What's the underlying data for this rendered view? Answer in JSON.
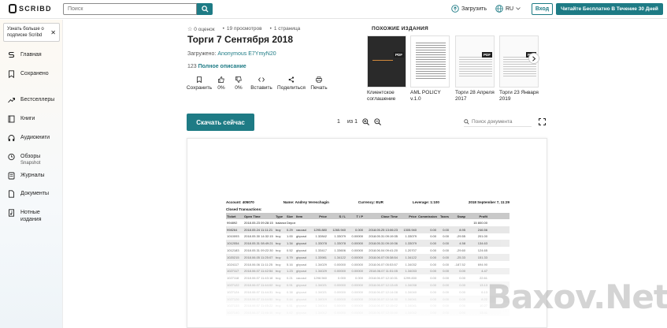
{
  "header": {
    "logo_text": "SCRIBD",
    "search_placeholder": "Поиск",
    "upload_label": "Загрузить",
    "lang_label": "RU",
    "login_label": "Вход",
    "cta_label": "Читайте Бесплатно В Течение 30 Дней"
  },
  "sidebar": {
    "promo_text": "Узнать больше о подписке Scribd",
    "items": [
      {
        "label": "Главная",
        "icon": "scribd-home-icon"
      },
      {
        "label": "Сохранено",
        "icon": "bookmark-icon"
      },
      {
        "label": "Бестселлеры",
        "icon": "trend-icon"
      },
      {
        "label": "Книги",
        "icon": "book-icon"
      },
      {
        "label": "Аудиокниги",
        "icon": "headphones-icon"
      },
      {
        "label": "Обзоры",
        "sub": "Snapshot",
        "icon": "snapshot-icon"
      },
      {
        "label": "Журналы",
        "icon": "magazine-icon"
      },
      {
        "label": "Документы",
        "icon": "document-icon"
      },
      {
        "label": "Нотные издания",
        "icon": "sheet-music-icon"
      }
    ]
  },
  "doc": {
    "rating": "0 оценок",
    "views": "19 просмотров",
    "pages": "1 страница",
    "title": "Торги 7 Сентября 2018",
    "uploaded_prefix": "Загружено:",
    "author": "Anonymous E7YmyN20",
    "desc_count": "123",
    "desc_link": "Полное описание",
    "actions": [
      {
        "label": "Сохранить",
        "icon": "bookmark-icon"
      },
      {
        "label": "0%",
        "icon": "thumbs-up-icon"
      },
      {
        "label": "0%",
        "icon": "thumbs-down-icon"
      },
      {
        "label": "Вставить",
        "icon": "embed-icon"
      },
      {
        "label": "Поделиться",
        "icon": "share-icon"
      },
      {
        "label": "Печать",
        "icon": "print-icon"
      }
    ],
    "download_label": "Скачать сейчас",
    "page_current": "1",
    "page_of": "из 1",
    "search_placeholder": "Поиск документа"
  },
  "similar": {
    "title": "ПОХОЖИЕ ИЗДАНИЯ",
    "items": [
      {
        "label": "Клиентское соглашение",
        "badge": "PDF"
      },
      {
        "label": "AML POLICY v.1.0",
        "badge": ""
      },
      {
        "label": "Торги 28 Апреля 2017",
        "badge": "PDF"
      },
      {
        "label": "Торги 23 Января 2019",
        "badge": "PDF"
      }
    ]
  },
  "sheet": {
    "account": "Account: 405070",
    "name": "Name: Andrey Vereschagin",
    "currency": "Currency: EUR",
    "leverage": "Leverage: 1:100",
    "date": "2018 September 7, 11:29",
    "section": "Closed Transactions:",
    "columns": [
      "Ticket",
      "Open Time",
      "Type",
      "Size",
      "Item",
      "Price",
      "S / L",
      "T / P",
      "Close Time",
      "Price",
      "Commission",
      "Taxes",
      "Swap",
      "Profit"
    ],
    "rows": [
      [
        "994892",
        "2018.05.23 09:28:15",
        "balance",
        "Deposit #968790",
        "",
        "",
        "",
        "",
        "",
        "",
        "",
        "",
        "",
        "15 800.00"
      ],
      [
        "998264",
        "2018.05.24 11:11:21",
        "buy",
        "0.29",
        "xauusd",
        "1295.880",
        "1265.940",
        "0.000",
        "2018.05.25 13:06:23",
        "1305.940",
        "0.00",
        "0.00",
        "8.95",
        "246.56"
      ],
      [
        "1010093",
        "2018.05.30 14:32:15",
        "buy",
        "1.00",
        "gbpusd",
        "1.32842",
        "1.33079",
        "0.00000",
        "2018.05.31 09:19:35",
        "1.33079",
        "0.00",
        "0.00",
        "-29.55",
        "201.00"
      ],
      [
        "1012054",
        "2018.05.31 08:49:21",
        "buy",
        "1.34",
        "gbpusd",
        "1.33078",
        "1.33078",
        "0.00000",
        "2018.05.31 09:19:36",
        "1.33079",
        "0.00",
        "0.00",
        "4.58",
        "134.63"
      ],
      [
        "1012183",
        "2018.05.31 09:22:30",
        "buy",
        "0.52",
        "gbpusd",
        "1.33417",
        "1.33606",
        "0.00000",
        "2018.06.04 09:41:20",
        "1.20707",
        "0.00",
        "0.00",
        "-29.60",
        "124.65"
      ],
      [
        "1020215",
        "2018.06.05 11:25:07",
        "buy",
        "0.79",
        "gbpusd",
        "1.33981",
        "1.34122",
        "0.00000",
        "2018.06.07 05:38:54",
        "1.34122",
        "0.00",
        "0.00",
        "-25.33",
        "151.33"
      ],
      [
        "1024117",
        "2018.06.06 11:11:25",
        "buy",
        "5.16",
        "gbpusd",
        "1.34029",
        "0.00000",
        "0.00000",
        "2018.06.07 05:53:57",
        "1.34032",
        "0.00",
        "0.00",
        "-187.52",
        "694.90"
      ],
      [
        "1027117",
        "2018.06.07 11:42:54",
        "buy",
        "1.23",
        "gbpusd",
        "1.34029",
        "0.00000",
        "0.00000",
        "2018.06.07 11:51:05",
        "1.34033",
        "0.00",
        "0.00",
        "0.00",
        "4.47"
      ],
      [
        "1027118",
        "2018.06.07 11:43:18",
        "buy",
        "0.21",
        "xauusd",
        "1298.560",
        "0.000",
        "0.000",
        "2018.06.07 12:10:31",
        "1299.830",
        "0.00",
        "0.00",
        "0.00",
        "22.61"
      ],
      [
        "1027122",
        "2018.06.07 11:44:02",
        "buy",
        "0.91",
        "gbpusd",
        "1.34021",
        "0.00000",
        "0.00000",
        "2018.06.07 12:13:45",
        "1.34038",
        "0.00",
        "0.00",
        "0.00",
        "13.13"
      ],
      [
        "1027124",
        "2018.06.07 11:44:31",
        "buy",
        "0.38",
        "gbpusd",
        "1.34021",
        "0.00000",
        "0.00000",
        "2018.06.07 12:14:08",
        "1.34040",
        "0.00",
        "0.00",
        "0.00",
        "6.13"
      ],
      [
        "1027126",
        "2018.06.07 11:44:50",
        "buy",
        "0.44",
        "gbpusd",
        "1.34019",
        "0.00000",
        "0.00000",
        "2018.06.07 12:14:30",
        "1.34041",
        "0.00",
        "0.00",
        "0.00",
        "8.22"
      ],
      [
        "1027133",
        "2018.06.07 11:45:22",
        "buy",
        "0.51",
        "gbpusd",
        "1.34014",
        "0.00000",
        "0.00000",
        "2018.06.07 12:15:02",
        "1.34041",
        "0.00",
        "0.00",
        "0.00",
        "10.27"
      ],
      [
        "1027140",
        "2018.06.07 11:46:10",
        "buy",
        "0.62",
        "gbpusd",
        "1.34012",
        "0.00000",
        "0.00000",
        "2018.06.07 12:15:40",
        "1.34042",
        "0.00",
        "0.00",
        "0.00",
        "13.91"
      ]
    ]
  },
  "watermark": "Baxov.Net",
  "colors": {
    "accent": "#1e7b85",
    "text": "#1e1e1e"
  }
}
